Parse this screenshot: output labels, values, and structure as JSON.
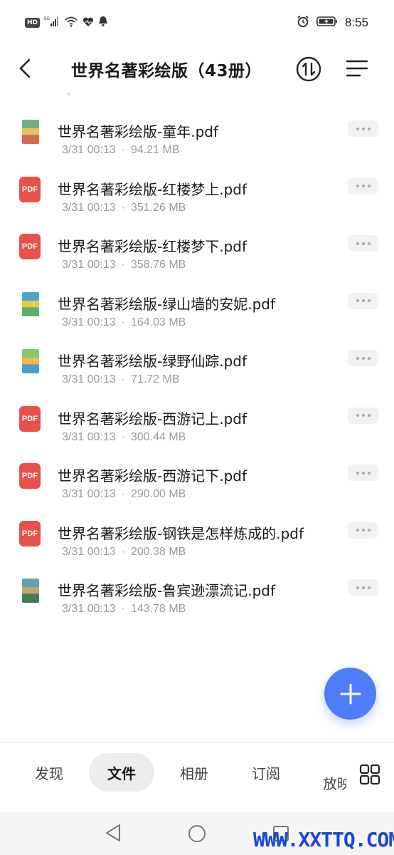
{
  "status_bar": {
    "hd": "HD",
    "network": "5G",
    "time": "8:55"
  },
  "header": {
    "title": "世界名著彩绘版（43册）"
  },
  "files": [
    {
      "name": "世界名著彩绘版-童年.pdf",
      "date": "3/31 00:13",
      "size": "94.21 MB",
      "thumb": "cover",
      "cover_colors": [
        "#6fb37a",
        "#e9c15c",
        "#d46a54"
      ]
    },
    {
      "name": "世界名著彩绘版-红楼梦上.pdf",
      "date": "3/31 00:13",
      "size": "351.26 MB",
      "thumb": "pdf",
      "thumb_label": "PDF"
    },
    {
      "name": "世界名著彩绘版-红楼梦下.pdf",
      "date": "3/31 00:13",
      "size": "358.76 MB",
      "thumb": "pdf",
      "thumb_label": "PDF"
    },
    {
      "name": "世界名著彩绘版-绿山墙的安妮.pdf",
      "date": "3/31 00:13",
      "size": "164.03 MB",
      "thumb": "cover",
      "cover_colors": [
        "#4aa7c9",
        "#f0c64a",
        "#5bb06a"
      ]
    },
    {
      "name": "世界名著彩绘版-绿野仙踪.pdf",
      "date": "3/31 00:13",
      "size": "71.72 MB",
      "thumb": "cover",
      "cover_colors": [
        "#8cc46a",
        "#f2b84a",
        "#4b9fd0"
      ]
    },
    {
      "name": "世界名著彩绘版-西游记上.pdf",
      "date": "3/31 00:13",
      "size": "300.44 MB",
      "thumb": "pdf",
      "thumb_label": "PDF"
    },
    {
      "name": "世界名著彩绘版-西游记下.pdf",
      "date": "3/31 00:13",
      "size": "290.00 MB",
      "thumb": "pdf",
      "thumb_label": "PDF"
    },
    {
      "name": "世界名著彩绘版-钢铁是怎样炼成的.pdf",
      "date": "3/31 00:13",
      "size": "200.38 MB",
      "thumb": "pdf",
      "thumb_label": "PDF"
    },
    {
      "name": "世界名著彩绘版-鲁宾逊漂流记.pdf",
      "date": "3/31 00:13",
      "size": "143.78 MB",
      "thumb": "cover",
      "cover_colors": [
        "#5aa4b8",
        "#c9a46a",
        "#3f7e5a"
      ]
    }
  ],
  "tabs": [
    {
      "label": "发现",
      "active": false
    },
    {
      "label": "文件",
      "active": true
    },
    {
      "label": "相册",
      "active": false
    },
    {
      "label": "订阅",
      "active": false
    },
    {
      "label": "放映",
      "active": false
    }
  ],
  "colors": {
    "accent": "#4f7dfa",
    "pdf_red": "#e8514b"
  },
  "watermark": "WWW.XXTTQ.COM"
}
